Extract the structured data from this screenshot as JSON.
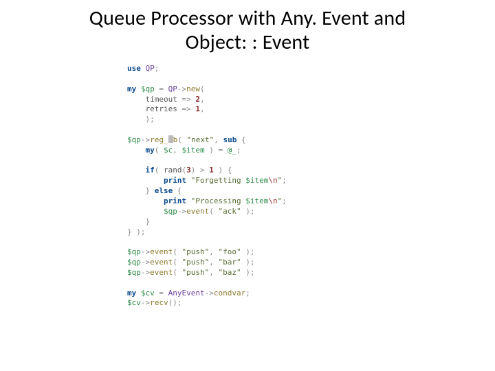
{
  "title": {
    "line1": "Queue Processor with Any. Event and",
    "line2": "Object: : Event"
  },
  "code": {
    "use": "use",
    "my": "my",
    "sub": "sub",
    "if": "if",
    "else": "else",
    "print": "print",
    "pkg_qp": "QP",
    "pkg_anyevent": "AnyEvent",
    "var_qp": "$qp",
    "var_c": "$c",
    "var_item": "$item",
    "var_args": "@_",
    "var_cv": "$cv",
    "meth_new": "new",
    "meth_regcb_prefix": "reg_",
    "meth_regcb_suffix": "b",
    "meth_event": "event",
    "meth_condvar": "condvar",
    "meth_recv": "recv",
    "key_timeout": "timeout",
    "key_retries": "retries",
    "num_2": "2",
    "num_1": "1",
    "num_3": "3",
    "num_1b": "1",
    "str_next": "\"next\"",
    "str_forget_a": "\"Forgetting ",
    "str_forget_b": "\"",
    "str_proc_a": "\"Processing ",
    "str_proc_b": "\"",
    "str_ack": "\"ack\"",
    "str_push": "\"push\"",
    "str_foo": "\"foo\"",
    "str_bar": "\"bar\"",
    "str_baz": "\"baz\"",
    "esc_n": "\\n",
    "fn_rand": "rand"
  }
}
